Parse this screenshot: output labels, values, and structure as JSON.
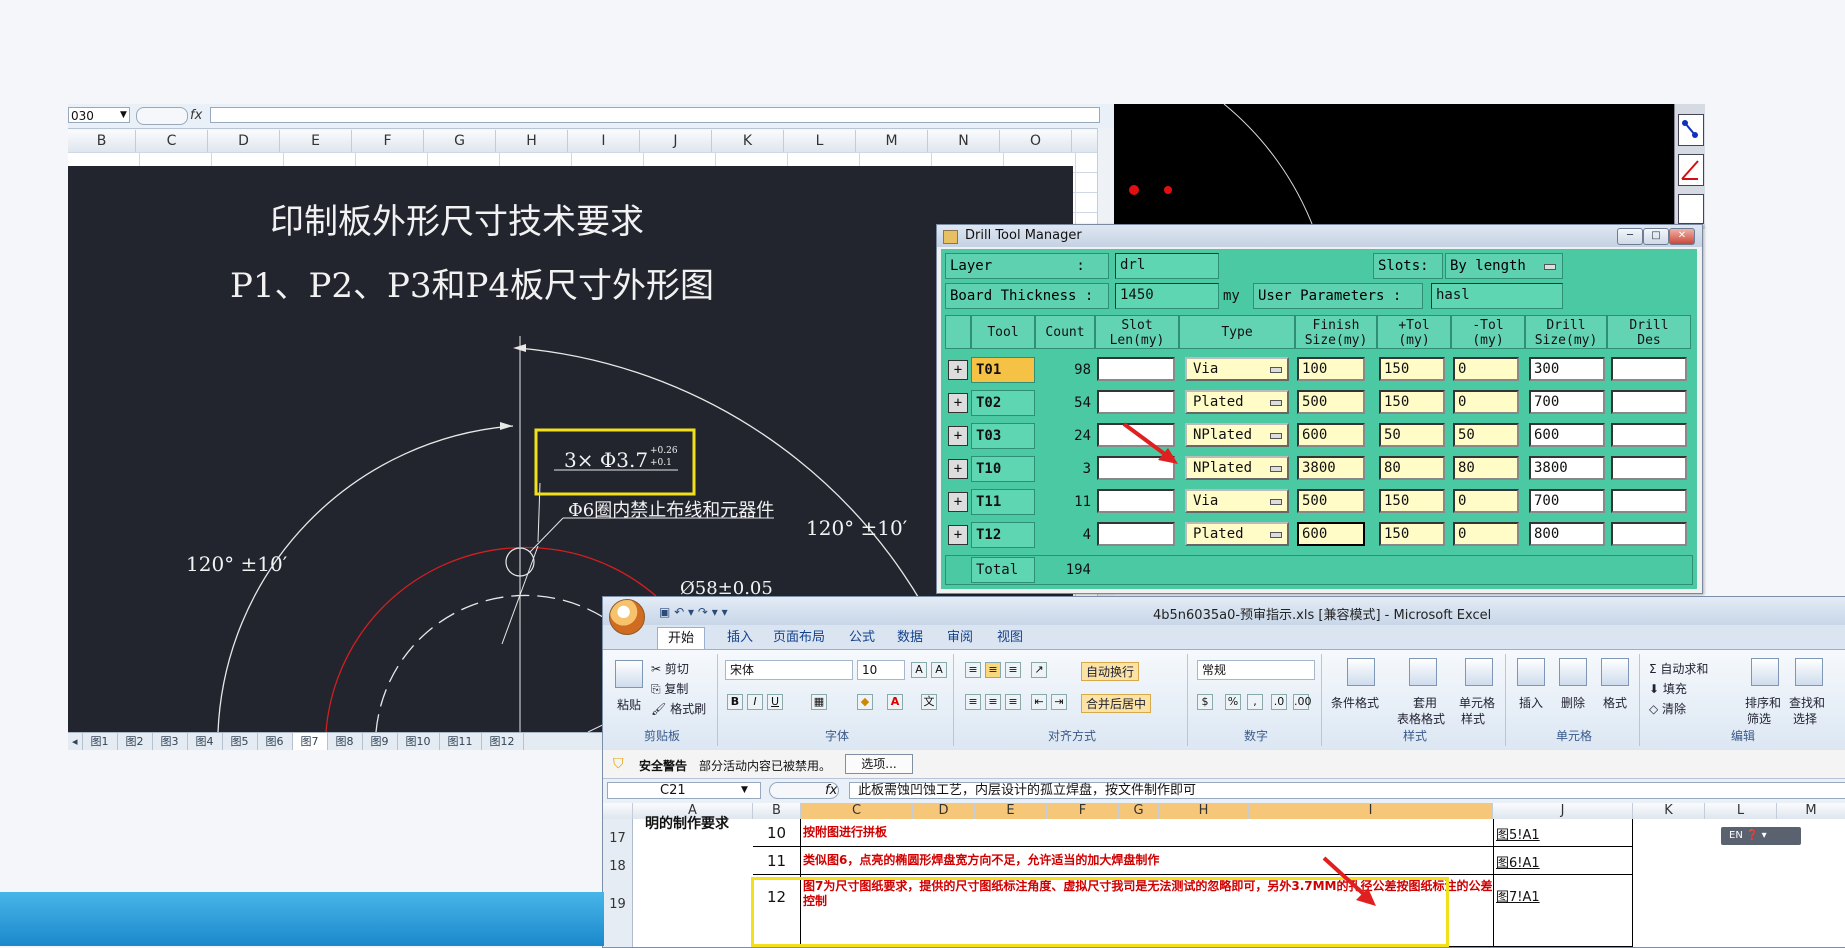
{
  "bg_excel": {
    "namebox": "030",
    "fx": "fx",
    "columns": [
      "B",
      "C",
      "D",
      "E",
      "F",
      "G",
      "H",
      "I",
      "J",
      "K",
      "L",
      "M",
      "N",
      "O"
    ],
    "sheet_tabs": [
      "图1",
      "图2",
      "图3",
      "图4",
      "图5",
      "图6",
      "图7",
      "图8",
      "图9",
      "图10",
      "图11",
      "图12"
    ]
  },
  "cad": {
    "title1": "印制板外形尺寸技术要求",
    "title2": "P1、P2、P3和P4板尺寸外形图",
    "hole_main": "3× Φ3.7",
    "hole_tol_plus": "+0.26",
    "hole_tol_minus": "+0.1",
    "note": "Φ6圈内禁止布线和元器件",
    "angle_left": "120° ±10′",
    "angle_right": "120° ±10′",
    "diameter": "Ø58±0.05",
    "colors": {
      "bg": "#22252e",
      "red": "#d21f1f",
      "highlight": "#f2e11a"
    }
  },
  "dtm": {
    "title": "Drill Tool Manager",
    "layer_label": "Layer          :",
    "layer_value": "drl",
    "slots_label": "Slots:",
    "slots_value": "By length",
    "thickness_label": "Board Thickness :",
    "thickness_value": "1450",
    "thickness_unit": "my",
    "user_params_label": "User Parameters :",
    "user_params_value": "hasl",
    "headers": [
      "Tool",
      "Count",
      "Slot\nLen(my)",
      "Type",
      "Finish\nSize(my)",
      "+Tol\n(my)",
      "-Tol\n(my)",
      "Drill\nSize(my)",
      "Drill\nDes"
    ],
    "rows": [
      {
        "tool": "T01",
        "count": "98",
        "type": "Via",
        "finish": "100",
        "ptol": "150",
        "ntol": "0",
        "drill": "300"
      },
      {
        "tool": "T02",
        "count": "54",
        "type": "Plated",
        "finish": "500",
        "ptol": "150",
        "ntol": "0",
        "drill": "700"
      },
      {
        "tool": "T03",
        "count": "24",
        "type": "NPlated",
        "finish": "600",
        "ptol": "50",
        "ntol": "50",
        "drill": "600"
      },
      {
        "tool": "T10",
        "count": "3",
        "type": "NPlated",
        "finish": "3800",
        "ptol": "80",
        "ntol": "80",
        "drill": "3800"
      },
      {
        "tool": "T11",
        "count": "11",
        "type": "Via",
        "finish": "500",
        "ptol": "150",
        "ntol": "0",
        "drill": "700"
      },
      {
        "tool": "T12",
        "count": "4",
        "type": "Plated",
        "finish": "600",
        "ptol": "150",
        "ntol": "0",
        "drill": "800"
      }
    ],
    "total_label": "Total",
    "total_value": "194",
    "colors": {
      "bg": "#4bc9a3",
      "input": "#fffcc8",
      "selected": "#f6c246"
    }
  },
  "excel": {
    "title": "4b5n6035a0-预审指示.xls  [兼容模式] - Microsoft Excel",
    "tabs": [
      "开始",
      "插入",
      "页面布局",
      "公式",
      "数据",
      "审阅",
      "视图"
    ],
    "clipboard": {
      "paste": "粘贴",
      "cut": "剪切",
      "copy": "复制",
      "format_painter": "格式刷",
      "label": "剪贴板"
    },
    "font": {
      "name": "宋体",
      "size": "10",
      "label": "字体"
    },
    "align": {
      "wrap": "自动换行",
      "merge": "合并后居中",
      "label": "对齐方式"
    },
    "number": {
      "format": "常规",
      "label": "数字"
    },
    "styles": {
      "cond": "条件格式",
      "table1": "套用",
      "table2": "表格格式",
      "cell1": "单元格",
      "cell2": "样式",
      "label": "样式"
    },
    "cells": {
      "insert": "插入",
      "delete": "删除",
      "format": "格式",
      "label": "单元格"
    },
    "edit": {
      "autosum": "自动求和",
      "fill": "填充",
      "clear": "清除",
      "sort1": "排序和",
      "sort2": "筛选",
      "find1": "查找和",
      "find2": "选择",
      "label": "编辑"
    },
    "security_title": "安全警告",
    "security_msg": "部分活动内容已被禁用。",
    "security_btn": "选项...",
    "namebox": "C21",
    "formula": "此板需蚀凹蚀工艺，内层设计的孤立焊盘，按文件制作即可",
    "columns": [
      "A",
      "B",
      "C",
      "D",
      "E",
      "F",
      "G",
      "H",
      "I",
      "J",
      "K",
      "L",
      "M"
    ],
    "a_text": "明的制作要求",
    "lang": "EN",
    "rows": [
      {
        "rn": "17",
        "b": "10",
        "text": "按附图进行拼板",
        "link": "图5!A1"
      },
      {
        "rn": "18",
        "b": "11",
        "text": "类似图6，点亮的椭圆形焊盘宽方向不足，允许适当的加大焊盘制作",
        "link": "图6!A1"
      },
      {
        "rn": "19",
        "b": "12",
        "text": "图7为尺寸图纸要求，提供的尺寸图纸标注角度、虚拟尺寸我司是无法测试的忽略即可，另外3.7MM的孔径公差按图纸标注的公差控制",
        "link": "图7!A1"
      }
    ]
  }
}
